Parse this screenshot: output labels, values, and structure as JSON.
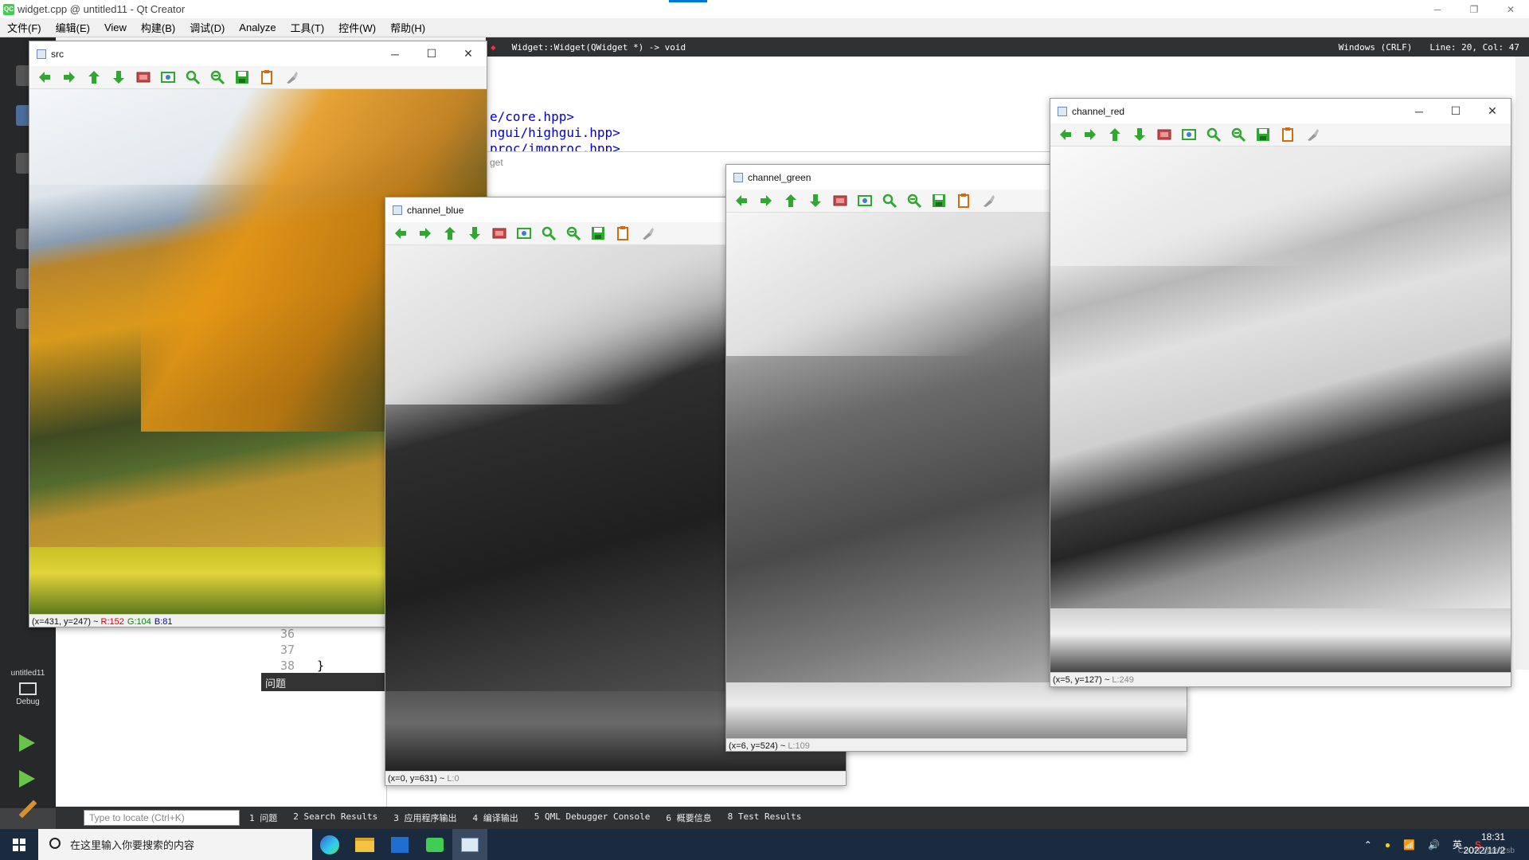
{
  "window": {
    "title": "widget.cpp @ untitled11 - Qt Creator",
    "app_badge": "QC"
  },
  "menu": [
    "文件(F)",
    "编辑(E)",
    "View",
    "构建(B)",
    "调试(D)",
    "Analyze",
    "工具(T)",
    "控件(W)",
    "帮助(H)"
  ],
  "editor": {
    "function": "Widget::Widget(QWidget *) -> void",
    "line_ending": "Windows (CRLF)",
    "cursor": "Line: 20, Col: 47",
    "code_lines": [
      "e/core.hpp>",
      "ngui/highgui.hpp>",
      "proc/imgproc.hpp>"
    ],
    "line_numbers": [
      "36",
      "37",
      "38"
    ],
    "closing_brace": "}",
    "issues_label": "问题",
    "hidden_window_title": "get"
  },
  "sidebar": {
    "kit_name": "untitled11",
    "kit_mode": "Debug"
  },
  "bottom": {
    "locate_placeholder": "Type to locate (Ctrl+K)",
    "tabs": [
      "1 问题",
      "2 Search Results",
      "3 应用程序输出",
      "4 编译输出",
      "5 QML Debugger Console",
      "6 概要信息",
      "8 Test Results"
    ]
  },
  "taskbar": {
    "search_placeholder": "在这里输入你要搜索的内容",
    "time": "18:31",
    "date": "2022/11/2",
    "ime": "英",
    "watermark": "CSDN @sslizsb"
  },
  "windows": {
    "src": {
      "title": "src",
      "status_pos": "(x=431, y=247) ~",
      "r": "R:152",
      "g": "G:104",
      "b": "B:81"
    },
    "blue": {
      "title": "channel_blue",
      "status_pos": "(x=0, y=631) ~",
      "level": "L:0"
    },
    "green": {
      "title": "channel_green",
      "status_pos": "(x=6, y=524) ~",
      "level": "L:109"
    },
    "red": {
      "title": "channel_red",
      "status_pos": "(x=5, y=127) ~",
      "level": "L:249"
    }
  },
  "toolbar_icons": [
    "pan-left-icon",
    "pan-right-icon",
    "pan-up-icon",
    "pan-down-icon",
    "zoom-actual-icon",
    "zoom-fit-icon",
    "zoom-in-icon",
    "zoom-out-icon",
    "save-icon",
    "properties-icon",
    "pick-icon"
  ],
  "colors": {
    "accent": "#0078d7",
    "qt_green": "#41cd52",
    "arrow_green": "#2fa82f",
    "code_blue": "#0000d5"
  }
}
